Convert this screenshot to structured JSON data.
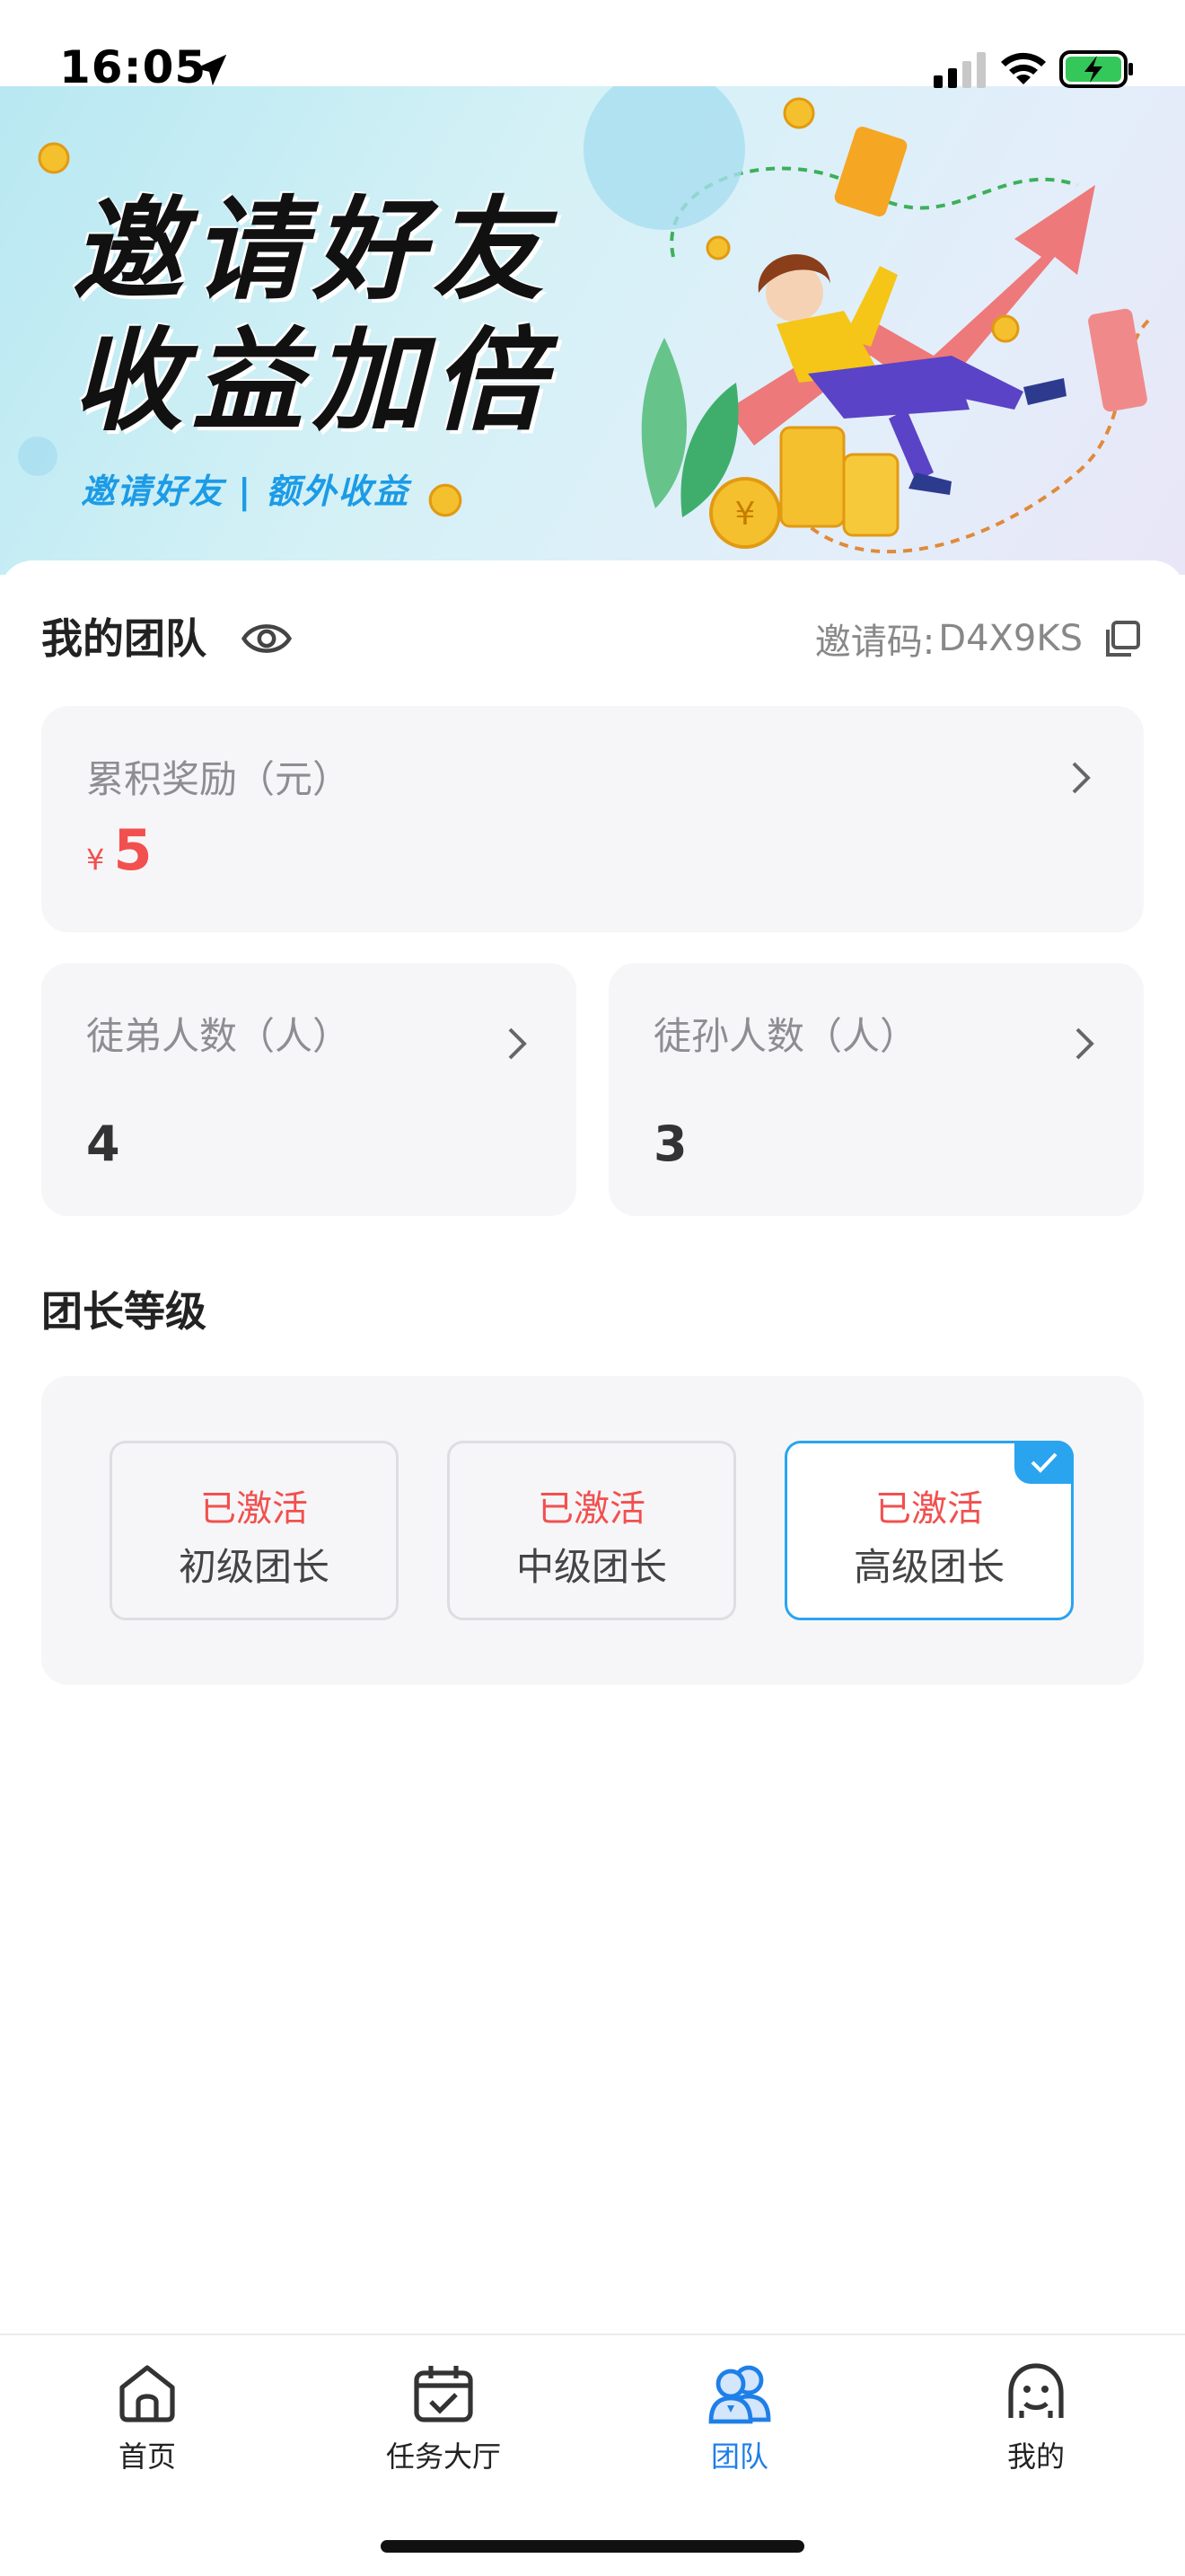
{
  "status_bar": {
    "time": "16:05"
  },
  "banner": {
    "title_line1": "邀请好友",
    "title_line2": "收益加倍",
    "subtitle": "邀请好友 | 额外收益"
  },
  "team": {
    "title": "我的团队",
    "invite_label": "邀请码:",
    "invite_code": "D4X9KS"
  },
  "reward": {
    "label": "累积奖励（元）",
    "currency": "¥",
    "amount": "5"
  },
  "counts": [
    {
      "label": "徒弟人数（人）",
      "value": "4"
    },
    {
      "label": "徒孙人数（人）",
      "value": "3"
    }
  ],
  "levels": {
    "title": "团长等级",
    "items": [
      {
        "status": "已激活",
        "name": "初级团长",
        "selected": false
      },
      {
        "status": "已激活",
        "name": "中级团长",
        "selected": false
      },
      {
        "status": "已激活",
        "name": "高级团长",
        "selected": true
      }
    ]
  },
  "tabs": [
    {
      "label": "首页",
      "icon": "home-icon",
      "active": false
    },
    {
      "label": "任务大厅",
      "icon": "calendar-check-icon",
      "active": false
    },
    {
      "label": "团队",
      "icon": "team-icon",
      "active": true
    },
    {
      "label": "我的",
      "icon": "profile-face-icon",
      "active": false
    }
  ],
  "colors": {
    "accent_blue": "#2aa4ef",
    "tab_active": "#1e7fe8",
    "reward_red": "#f1504f"
  }
}
